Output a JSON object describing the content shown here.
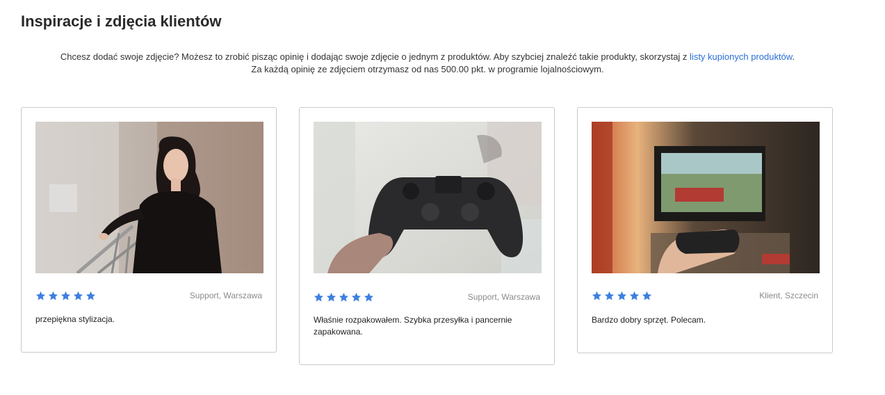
{
  "page": {
    "title": "Inspiracje i zdjęcia klientów",
    "intro": {
      "line1_prefix": "Chcesz dodać swoje zdjęcie? Możesz to zrobić pisząc opinię i dodając swoje zdjęcie o jednym z produktów. Aby szybciej znaleźć takie produkty, skorzystaj z ",
      "link_label": "listy kupionych produktów",
      "line1_suffix": ".",
      "line2": "Za każdą opinię ze zdjęciem otrzymasz od nas 500.00 pkt. w programie lojalnościowym."
    }
  },
  "colors": {
    "link": "#2a6fd6",
    "star": "#3d7fe0",
    "border": "#c9c9c9"
  },
  "reviews": [
    {
      "photo_icon": "woman-portrait-photo",
      "rating": 5,
      "author": "Support, Warszawa",
      "text": "przepiękna stylizacja."
    },
    {
      "photo_icon": "gamepad-photo",
      "rating": 5,
      "author": "Support, Warszawa",
      "text": "Właśnie rozpakowałem. Szybka przesyłka i pancernie zapakowana."
    },
    {
      "photo_icon": "tv-gaming-photo",
      "rating": 5,
      "author": "Klient, Szczecin",
      "text": "Bardzo dobry sprzęt. Polecam."
    }
  ]
}
